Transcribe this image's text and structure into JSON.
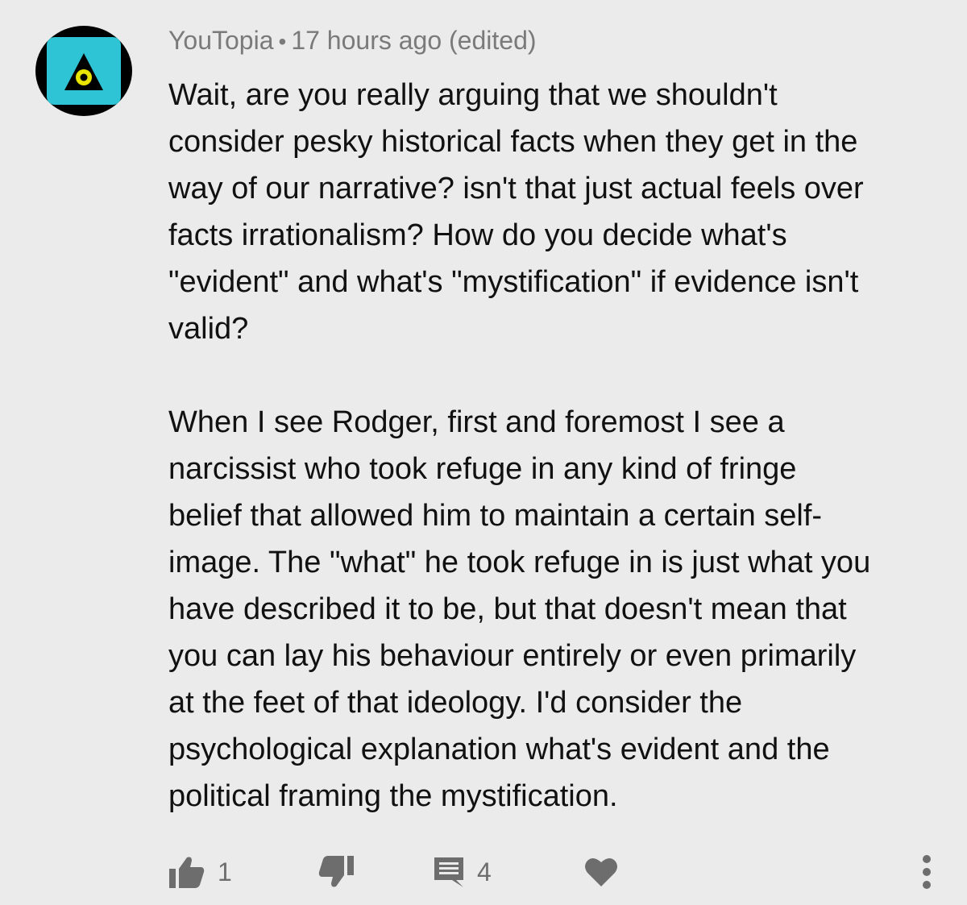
{
  "comment": {
    "author": "YouTopia",
    "separator": "•",
    "time": "17 hours ago (edited)",
    "paragraphs": [
      "Wait, are you really arguing that we shouldn't\nconsider pesky historical facts when they get in the\nway of our narrative? isn't that just actual feels over\nfacts irrationalism? How do you decide what's\n\"evident\" and what's \"mystification\" if evidence isn't\nvalid?",
      "When I see Rodger, first and foremost I see a\nnarcissist who took refuge in any kind of fringe\nbelief that allowed him to maintain a certain self-\nimage. The \"what\" he took refuge in is just what you\nhave described it to be, but that doesn't mean that\nyou can lay his behaviour entirely or even primarily\nat the feet of that ideology. I'd consider the\npsychological explanation what's evident and the\npolitical framing the mystification."
    ],
    "actions": {
      "like_count": "1",
      "reply_count": "4"
    }
  },
  "icons": {
    "avatar": "illuminati-eye-triangle-avatar",
    "like": "thumbs-up-icon",
    "dislike": "thumbs-down-icon",
    "reply": "comment-reply-icon",
    "heart": "heart-icon",
    "more": "more-vertical-icon"
  },
  "colors": {
    "background": "#ebebeb",
    "avatar_teal": "#2ec4d6",
    "text": "#111111",
    "meta": "#7a7a7a",
    "icon": "#6d6d6d"
  }
}
